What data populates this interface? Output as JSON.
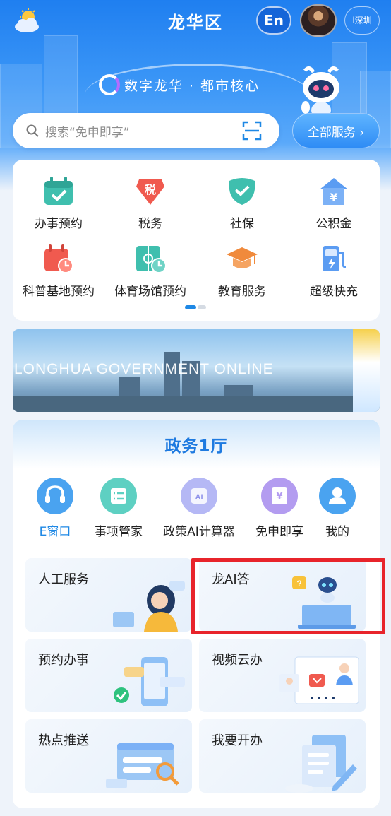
{
  "header": {
    "title": "龙华区",
    "lang_button": "En",
    "city_switch": "i深圳",
    "slogan": "数字龙华 · 都市核心"
  },
  "search": {
    "placeholder": "搜索“免申即享”",
    "all_services": "全部服务 ›"
  },
  "quick_services": [
    {
      "label": "办事预约",
      "icon": "calendar-check-icon",
      "color": "#3fbfae"
    },
    {
      "label": "税务",
      "icon": "tax-shield-icon",
      "color": "#f05a4f"
    },
    {
      "label": "社保",
      "icon": "social-security-shield-icon",
      "color": "#3fbfae"
    },
    {
      "label": "公积金",
      "icon": "housing-fund-icon",
      "color": "#5b9cf2"
    },
    {
      "label": "科普基地预约",
      "icon": "science-calendar-icon",
      "color": "#f05a4f"
    },
    {
      "label": "体育场馆预约",
      "icon": "sports-venue-icon",
      "color": "#3fbfae"
    },
    {
      "label": "教育服务",
      "icon": "graduation-cap-icon",
      "color": "#f08a3c"
    },
    {
      "label": "超级快充",
      "icon": "fast-charge-icon",
      "color": "#5b9cf2"
    }
  ],
  "banner": {
    "text": "LONGHUA GOVERNMENT ONLINE"
  },
  "hall": {
    "title": "政务1厅",
    "entries": [
      {
        "label": "E窗口",
        "icon": "headset-icon",
        "active": true
      },
      {
        "label": "事项管家",
        "icon": "list-icon",
        "active": false
      },
      {
        "label": "政策AI计算器",
        "icon": "ai-icon",
        "active": false
      },
      {
        "label": "免申即享",
        "icon": "yuan-document-icon",
        "active": false
      },
      {
        "label": "我的",
        "icon": "user-icon",
        "active": false
      }
    ],
    "services": [
      {
        "label": "人工服务"
      },
      {
        "label": "龙AI答"
      },
      {
        "label": "预约办事"
      },
      {
        "label": "视频云办"
      },
      {
        "label": "热点推送"
      },
      {
        "label": "我要开办"
      }
    ]
  },
  "colors": {
    "primary": "#1f7ff0",
    "hall_title": "#1e7ae0",
    "active_entry": "#1e88e5",
    "highlight_box": "#e8242b"
  }
}
